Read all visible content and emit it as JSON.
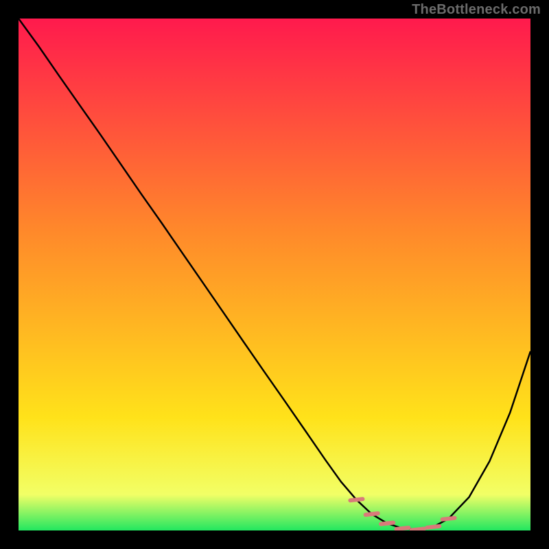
{
  "attribution": "TheBottleneck.com",
  "chart_data": {
    "type": "line",
    "title": "",
    "xlabel": "",
    "ylabel": "",
    "xlim": [
      0,
      100
    ],
    "ylim": [
      0,
      100
    ],
    "background_gradient": {
      "top": "#ff1a4d",
      "mid_upper": "#ff8a2a",
      "mid_lower": "#ffe21a",
      "bottom": "#22e760"
    },
    "series": [
      {
        "name": "bottleneck-curve",
        "stroke": "#000000",
        "x": [
          0,
          4,
          8,
          12,
          16,
          20,
          24,
          28,
          32,
          36,
          40,
          44,
          48,
          52,
          56,
          60,
          63,
          66,
          69,
          72,
          75,
          78,
          81,
          84,
          88,
          92,
          96,
          100
        ],
        "y": [
          100,
          94.5,
          88.7,
          83,
          77.3,
          71.5,
          65.7,
          60,
          54.2,
          48.4,
          42.6,
          36.8,
          31,
          25.3,
          19.5,
          13.7,
          9.5,
          6,
          3.2,
          1.4,
          0.4,
          0.2,
          0.7,
          2.3,
          6.5,
          13.5,
          23,
          35
        ],
        "note": "y values are percentage-of-range estimates (0 = bottom/green, 100 = top/red) read off the image; no numeric axis labels are visible."
      },
      {
        "name": "highlight-segments",
        "stroke": "#d97a7a",
        "note": "short pink tick segments overlaid near the valley of the curve",
        "segments": [
          {
            "x": 66,
            "y": 6
          },
          {
            "x": 69,
            "y": 3.2
          },
          {
            "x": 72,
            "y": 1.4
          },
          {
            "x": 75,
            "y": 0.4
          },
          {
            "x": 78,
            "y": 0.2
          },
          {
            "x": 81,
            "y": 0.7
          },
          {
            "x": 84,
            "y": 2.3
          }
        ]
      }
    ]
  }
}
